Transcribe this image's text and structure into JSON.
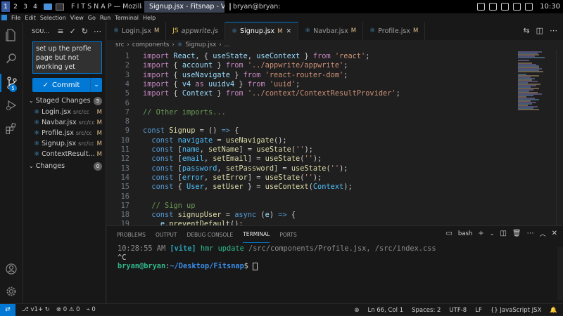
{
  "os_bar": {
    "workspaces": [
      "1",
      "2",
      "3",
      "4"
    ],
    "windows": [
      {
        "label": "F I T S N A P — Mozilla...",
        "color": "#e66000"
      },
      {
        "label": "Signup.jsx - Fitsnap - V...",
        "color": "#2b88d8"
      },
      {
        "label": "bryan@bryan: ~",
        "color": "#444444"
      }
    ],
    "clock": "10:30"
  },
  "menu": [
    "File",
    "Edit",
    "Selection",
    "View",
    "Go",
    "Run",
    "Terminal",
    "Help"
  ],
  "sidebar": {
    "title": "SOU...",
    "commit_message": "set up the profle page but not working yet",
    "commit_label": "Commit",
    "staged_header": "Staged Changes",
    "staged_count": "5",
    "staged_files": [
      {
        "name": "Login.jsx",
        "path": "src/co...",
        "status": "M"
      },
      {
        "name": "Navbar.jsx",
        "path": "src/co...",
        "status": "M"
      },
      {
        "name": "Profile.jsx",
        "path": "src/co...",
        "status": "M"
      },
      {
        "name": "Signup.jsx",
        "path": "src/co...",
        "status": "M"
      },
      {
        "name": "ContextResult...",
        "path": "",
        "status": "M"
      }
    ],
    "changes_header": "Changes",
    "changes_count": "0",
    "source_control_badge": "5"
  },
  "tabs": [
    {
      "name": "Login.jsx",
      "mod": "M",
      "type": "jsx"
    },
    {
      "name": "appwrite.js",
      "mod": "",
      "type": "js"
    },
    {
      "name": "Signup.jsx",
      "mod": "M",
      "type": "jsx",
      "active": true
    },
    {
      "name": "Navbar.jsx",
      "mod": "M",
      "type": "jsx"
    },
    {
      "name": "Profile.jsx",
      "mod": "M",
      "type": "jsx"
    }
  ],
  "breadcrumb": [
    "src",
    "components",
    "Signup.jsx",
    "..."
  ],
  "code_lines": [
    {
      "n": "1",
      "html": "<span class='kw2'>import</span> <span class='var'>React</span>, { <span class='var'>useState</span>, <span class='var'>useContext</span> } <span class='kw2'>from</span> <span class='str'>'react'</span>;"
    },
    {
      "n": "2",
      "html": "<span class='kw2'>import</span> { <span class='var'>account</span> } <span class='kw2'>from</span> <span class='str'>'../appwrite/appwrite'</span>;"
    },
    {
      "n": "3",
      "html": "<span class='kw2'>import</span> { <span class='var'>useNavigate</span> } <span class='kw2'>from</span> <span class='str'>'react-router-dom'</span>;"
    },
    {
      "n": "4",
      "html": "<span class='kw2'>import</span> { <span class='var'>v4</span> <span class='kw2'>as</span> <span class='var'>uuidv4</span> } <span class='kw2'>from</span> <span class='str'>'uuid'</span>;"
    },
    {
      "n": "5",
      "html": "<span class='kw2'>import</span> { <span class='var'>Context</span> } <span class='kw2'>from</span> <span class='str'>'../context/ContextResultProvider'</span>;"
    },
    {
      "n": "6",
      "html": ""
    },
    {
      "n": "7",
      "html": "<span class='cm'>// Other imports...</span>"
    },
    {
      "n": "8",
      "html": ""
    },
    {
      "n": "9",
      "html": "<span class='kw'>const</span> <span class='fn'>Signup</span> = () <span class='kw'>=&gt;</span> {"
    },
    {
      "n": "10",
      "html": "  <span class='kw'>const</span> <span class='con'>navigate</span> = <span class='fn'>useNavigate</span>();"
    },
    {
      "n": "11",
      "html": "  <span class='kw'>const</span> [<span class='con'>name</span>, <span class='fn'>setName</span>] = <span class='fn'>useState</span>(<span class='str'>''</span>);"
    },
    {
      "n": "12",
      "html": "  <span class='kw'>const</span> [<span class='con'>email</span>, <span class='fn'>setEmail</span>] = <span class='fn'>useState</span>(<span class='str'>''</span>);"
    },
    {
      "n": "13",
      "html": "  <span class='kw'>const</span> [<span class='con'>password</span>, <span class='fn'>setPassword</span>] = <span class='fn'>useState</span>(<span class='str'>''</span>);"
    },
    {
      "n": "14",
      "html": "  <span class='kw'>const</span> [<span class='con'>error</span>, <span class='fn'>setError</span>] = <span class='fn'>useState</span>(<span class='str'>''</span>);"
    },
    {
      "n": "15",
      "html": "  <span class='kw'>const</span> { <span class='con'>User</span>, <span class='fn'>setUser</span> } = <span class='fn'>useContext</span>(<span class='con'>Context</span>);"
    },
    {
      "n": "16",
      "html": ""
    },
    {
      "n": "17",
      "html": "  <span class='cm'>// Sign up</span>"
    },
    {
      "n": "18",
      "html": "  <span class='kw'>const</span> <span class='fn'>signupUser</span> = <span class='kw'>async</span> (<span class='var'>e</span>) <span class='kw'>=&gt;</span> {"
    },
    {
      "n": "19",
      "html": "    <span class='var'>e</span>.<span class='fn'>preventDefault</span>();"
    }
  ],
  "panel": {
    "tabs": [
      "PROBLEMS",
      "OUTPUT",
      "DEBUG CONSOLE",
      "TERMINAL",
      "PORTS"
    ],
    "active_tab": "TERMINAL",
    "shell_label": "bash",
    "terminal": {
      "time": "10:28:55 AM",
      "tag": "[vite]",
      "msg_a": "hmr update",
      "msg_b": "/src/components/Profile.jsx, /src/index.css",
      "ctrl_c": "^C",
      "prompt_user": "bryan@bryan",
      "prompt_sep": ":",
      "prompt_path": "~/Desktop/Fitsnap",
      "prompt_end": "$"
    }
  },
  "status": {
    "branch": "v1+",
    "errors": "0",
    "warnings": "0",
    "ports": "0",
    "position": "Ln 66, Col 1",
    "spaces": "Spaces: 2",
    "encoding": "UTF-8",
    "eol": "LF",
    "language": "JavaScript JSX"
  }
}
